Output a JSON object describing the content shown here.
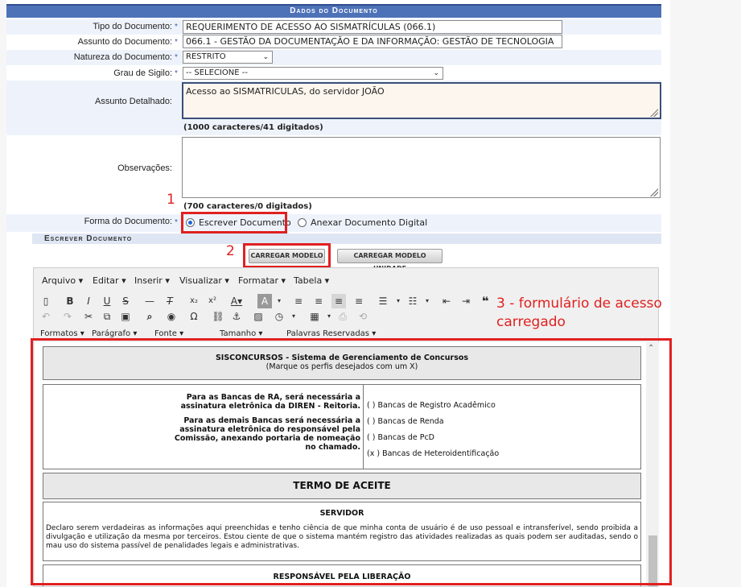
{
  "section_title": "Dados do Documento",
  "fields": {
    "tipo": {
      "label": "Tipo do Documento:",
      "value": "REQUERIMENTO DE ACESSO AO SISMATRÍCULAS (066.1)"
    },
    "assunto": {
      "label": "Assunto do Documento:",
      "value": "066.1 - GESTÃO DA DOCUMENTAÇÃO E DA INFORMAÇÃO: GESTÃO DE TECNOLOGIA"
    },
    "natureza": {
      "label": "Natureza do Documento:",
      "value": "RESTRITO"
    },
    "sigilo": {
      "label": "Grau de Sigilo:",
      "value": "-- SELECIONE --"
    },
    "assunto_detalhado": {
      "label": "Assunto Detalhado:",
      "value": "Acesso ao SISMATRICULAS, do servidor JOÃO",
      "counter": "(1000 caracteres/41 digitados)"
    },
    "observacoes": {
      "label": "Observações:",
      "value": "",
      "counter": "(700 caracteres/0 digitados)"
    },
    "forma": {
      "label": "Forma do Documento:",
      "option1": "Escrever Documento",
      "option2": "Anexar Documento Digital"
    }
  },
  "required_mark": "*",
  "subsection_title": "Escrever Documento",
  "buttons": {
    "carregar_modelo": "CARREGAR MODELO",
    "carregar_modelo_unidade": "CARREGAR MODELO UNIDADE"
  },
  "annotations": {
    "n1": "1",
    "n2": "2",
    "n3": "3 - formulário de acesso carregado"
  },
  "editor": {
    "menus": [
      "Arquivo",
      "Editar",
      "Inserir",
      "Visualizar",
      "Formatar",
      "Tabela"
    ],
    "format_menus": [
      "Formatos",
      "Parágrafo",
      "Fonte",
      "Tamanho",
      "Palavras Reservadas"
    ]
  },
  "document": {
    "header_title": "SISCONCURSOS - Sistema de Gerenciamento de Concursos",
    "header_sub": "(Marque os perfis desejados com um X)",
    "left_text_1": "Para as Bancas de RA, será necessária a assinatura eletrônica da DIREN - Reitoria.",
    "left_text_2": "Para as demais Bancas será necessária a assinatura eletrônica do responsável pela Comissão, anexando portaria de nomeação no chamado.",
    "options": [
      "( ) Bancas de Registro Acadêmico",
      "( ) Bancas de Renda",
      "( ) Bancas de PcD",
      "(x ) Bancas de Heteroidentificação"
    ],
    "termo_title": "TERMO DE ACEITE",
    "servidor_title": "SERVIDOR",
    "servidor_text": "Declaro serem verdadeiras as informações aqui preenchidas e tenho ciência de que minha conta de usuário é de uso pessoal e intransferível, sendo proibida a divulgação e utilização da mesma por terceiros. Estou ciente de que o sistema mantém registro das atividades realizadas as quais podem ser auditadas, sendo o mau uso do sistema passível de penalidades legais e administrativas.",
    "responsavel_title": "RESPONSÁVEL PELA LIBERAÇÃO"
  }
}
